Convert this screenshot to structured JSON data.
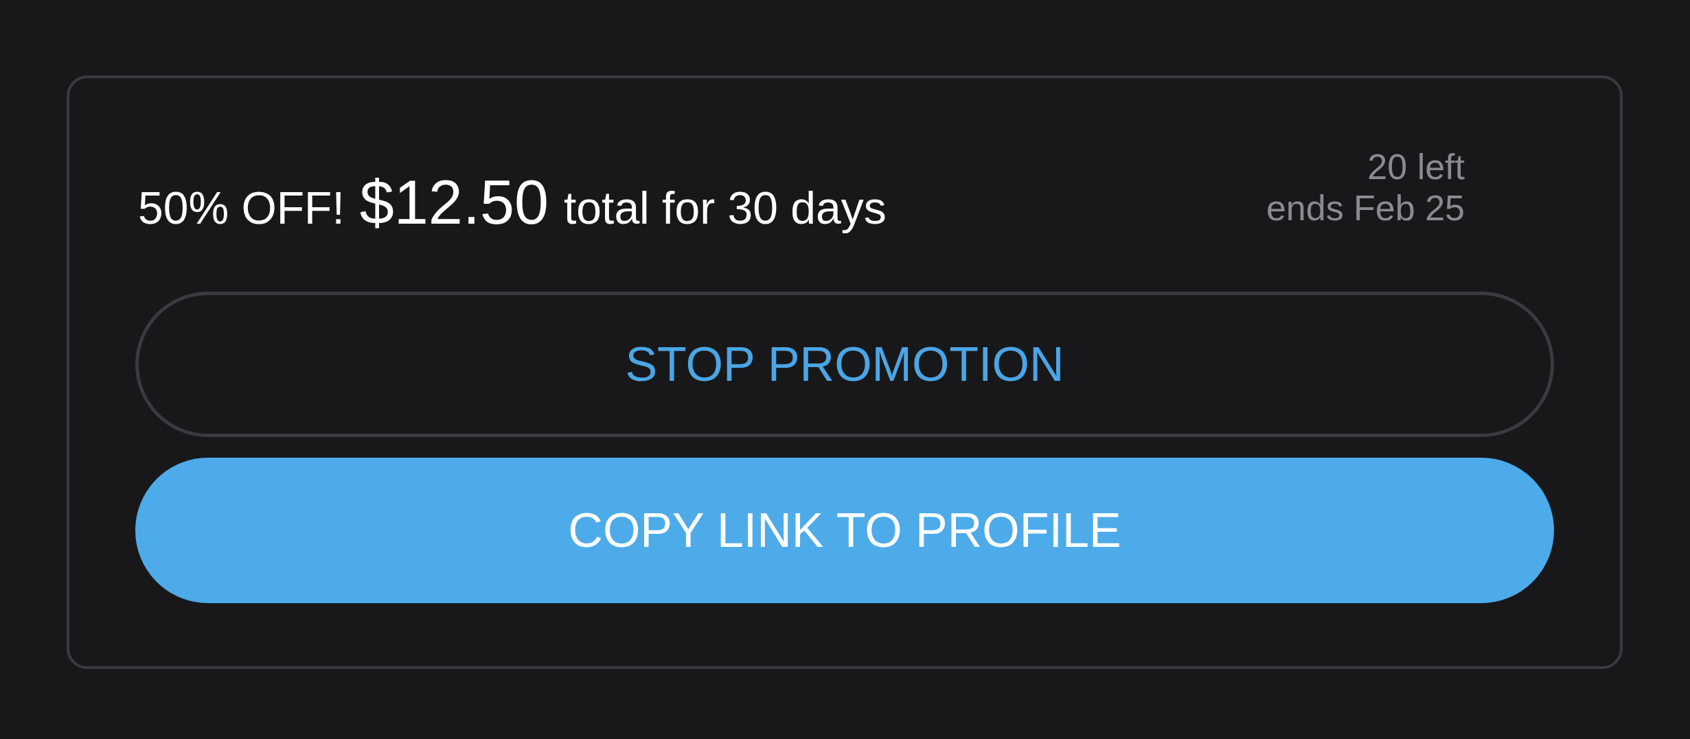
{
  "promotion": {
    "discount": "50% OFF!",
    "price": "$12.50",
    "terms": "total for 30 days",
    "remaining": "20 left",
    "ends": "ends Feb 25"
  },
  "buttons": [
    {
      "label": "STOP PROMOTION",
      "kind": "outline"
    },
    {
      "label": "COPY LINK TO PROFILE",
      "kind": "filled"
    }
  ]
}
